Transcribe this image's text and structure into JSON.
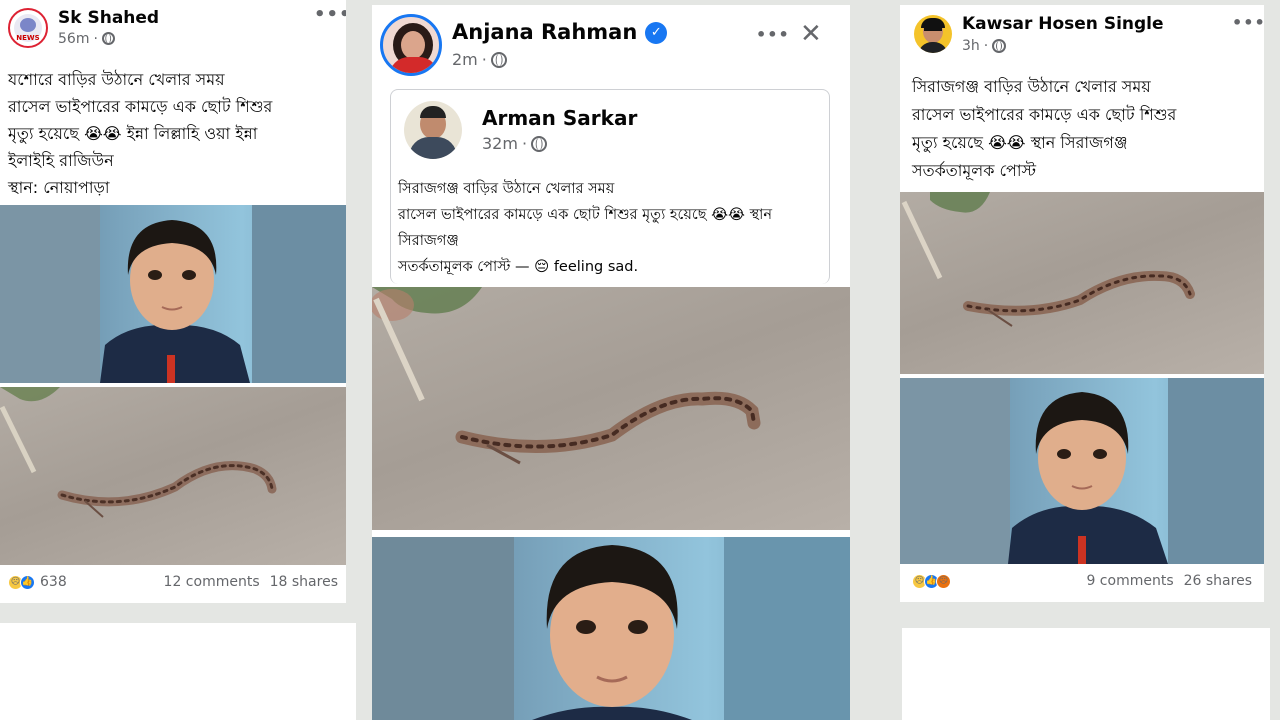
{
  "post_left": {
    "author": "Sk Shahed",
    "time": "56m",
    "avatar_text": "NEWS",
    "text_lines": [
      "যশোরে বাড়ির উঠানে খেলার সময়",
      "রাসেল ভাইপারের কামড়ে এক ছোট শিশুর",
      "মৃত্যু হয়েছে 😭😭 ইন্না লিল্লাহি ওয়া ইন্না",
      "ইলাইহি রাজিউন",
      "স্থান: নোয়াপাড়া"
    ],
    "reaction_count": "638",
    "comments": "12 comments",
    "shares": "18 shares"
  },
  "post_center": {
    "author": "Anjana Rahman",
    "time": "2m",
    "shared_author": "Arman Sarkar",
    "shared_time": "32m",
    "text_lines": [
      "সিরাজগঞ্জ  বাড়ির উঠানে খেলার সময়",
      "রাসেল ভাইপারের কামড়ে এক ছোট শিশুর মৃত্যু হয়েছে 😭😭 স্থান",
      "সিরাজগঞ্জ",
      "সতর্কতামূলক পোস্ট — 😔 feeling sad."
    ]
  },
  "post_right": {
    "author": "Kawsar Hosen Single",
    "time": "3h",
    "text_lines": [
      "সিরাজগঞ্জ  বাড়ির উঠানে খেলার সময়",
      "রাসেল ভাইপারের কামড়ে এক ছোট শিশুর",
      "মৃত্যু হয়েছে 😭😭 স্থান সিরাজগঞ্জ",
      "সতর্কতামূলক পোস্ট"
    ],
    "comments": "9 comments",
    "shares": "26 shares"
  },
  "icons": {
    "more": "more-icon",
    "close": "close-icon",
    "globe": "globe-icon",
    "verified": "verified-badge-icon"
  },
  "colors": {
    "facebook_blue": "#1877f2",
    "meta_gray": "#65676b"
  }
}
